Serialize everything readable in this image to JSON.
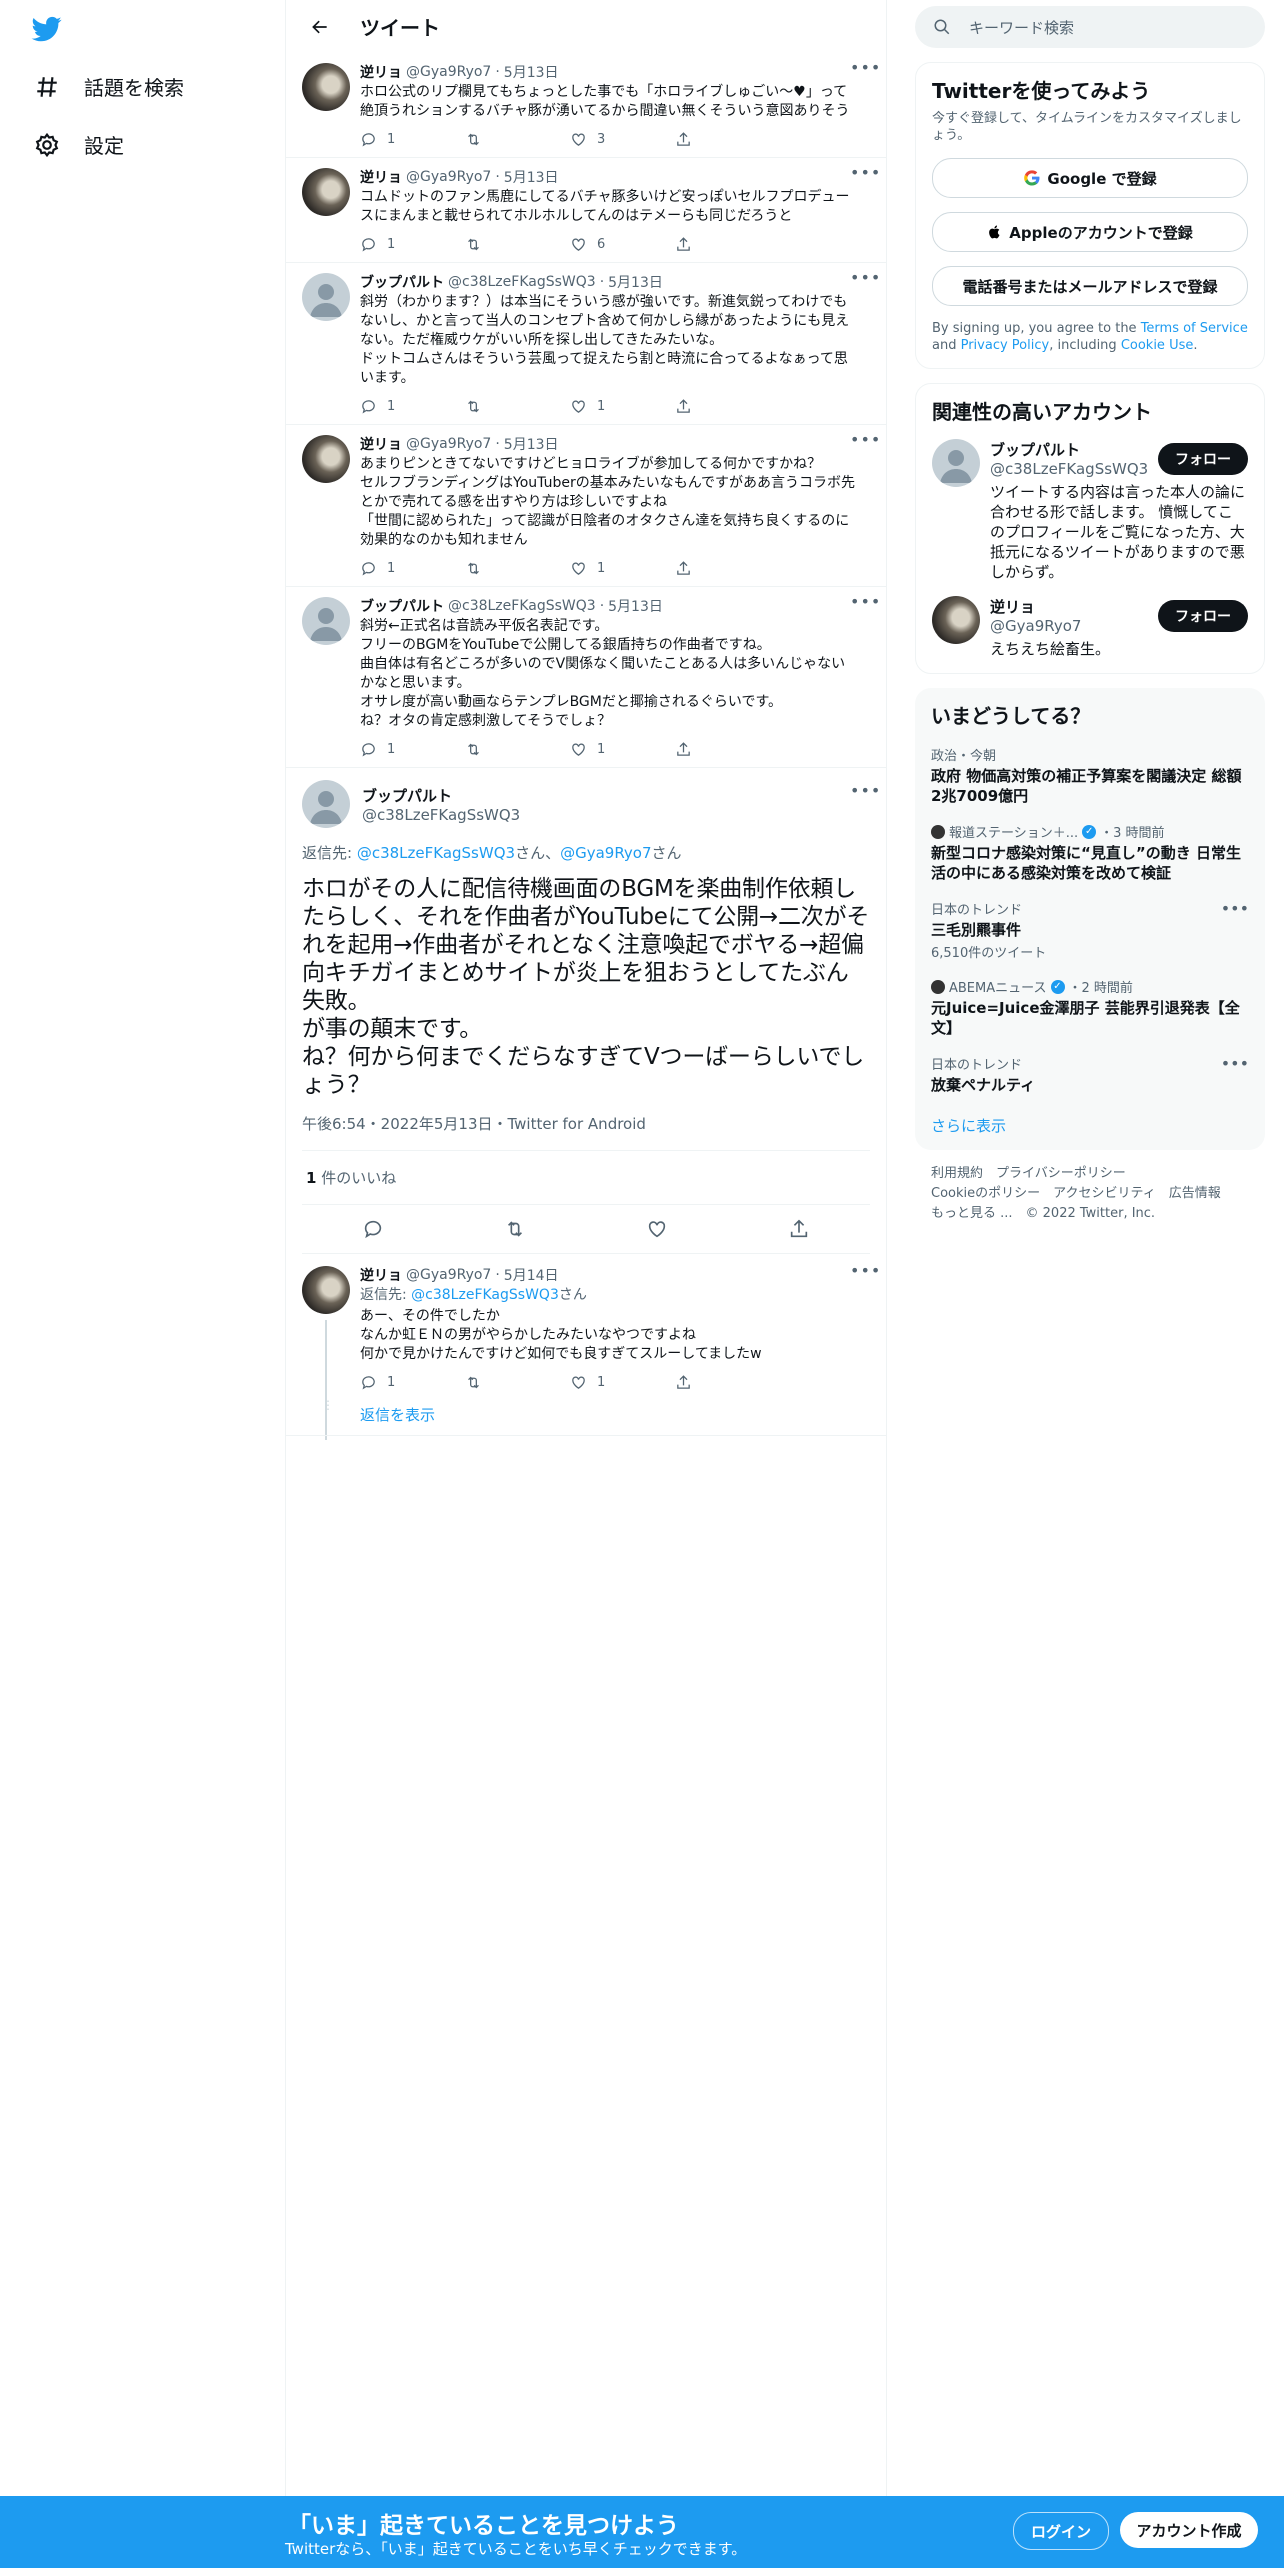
{
  "nav": {
    "explore_label": "話題を検索",
    "settings_label": "設定"
  },
  "header": {
    "title": "ツイート"
  },
  "replies_before": [
    {
      "name": "逆リョ",
      "handle": "@Gya9Ryo7",
      "date": "5月13日",
      "text": "ホロ公式のリプ欄見てもちょっとした事でも「ホロライブしゅごい〜♥」って絶頂うれションするバチャ豚が湧いてるから間違い無くそういう意図ありそう",
      "avatar": "dark",
      "replies": "1",
      "retweets": "",
      "likes": "3"
    },
    {
      "name": "逆リョ",
      "handle": "@Gya9Ryo7",
      "date": "5月13日",
      "text": "コムドットのファン馬鹿にしてるバチャ豚多いけど安っぽいセルフプロデュースにまんまと載せられてホルホルしてんのはテメーらも同じだろうと",
      "avatar": "dark",
      "replies": "1",
      "retweets": "",
      "likes": "6"
    },
    {
      "name": "ブップパルト",
      "handle": "@c38LzeFKagSsWQ3",
      "date": "5月13日",
      "text": "斜労（わかります？）は本当にそういう感が強いです。新進気鋭ってわけでもないし、かと言って当人のコンセプト含めて何かしら縁があったようにも見えない。ただ権威ウケがいい所を探し出してきたみたいな。\nドットコムさんはそういう芸風って捉えたら割と時流に合ってるよなぁって思います。",
      "avatar": "default",
      "replies": "1",
      "retweets": "",
      "likes": "1"
    },
    {
      "name": "逆リョ",
      "handle": "@Gya9Ryo7",
      "date": "5月13日",
      "text": "あまりピンときてないですけどヒョロライブが参加してる何かですかね？\nセルフブランディングはYouTuberの基本みたいなもんですがああ言うコラボ先とかで売れてる感を出すやり方は珍しいですよね\n「世間に認められた」って認識が日陰者のオタクさん達を気持ち良くするのに効果的なのかも知れません",
      "avatar": "dark",
      "replies": "1",
      "retweets": "",
      "likes": "1"
    },
    {
      "name": "ブップパルト",
      "handle": "@c38LzeFKagSsWQ3",
      "date": "5月13日",
      "text": "斜労←正式名は音読み平仮名表記です。\nフリーのBGMをYouTubeで公開してる銀盾持ちの作曲者ですね。\n曲自体は有名どころが多いのでV関係なく聞いたことある人は多いんじゃないかなと思います。\nオサレ度が高い動画ならテンプレBGMだと揶揄されるぐらいです。\nね？オタの肯定感刺激してそうでしょ？",
      "avatar": "default",
      "replies": "1",
      "retweets": "",
      "likes": "1"
    }
  ],
  "focus": {
    "name": "ブップパルト",
    "handle": "@c38LzeFKagSsWQ3",
    "reply_prefix": "返信先: ",
    "reply_to_1": "@c38LzeFKagSsWQ3",
    "reply_san_1": "さん、",
    "reply_to_2": "@Gya9Ryo7",
    "reply_san_2": "さん",
    "text": "ホロがその人に配信待機画面のBGMを楽曲制作依頼したらしく、それを作曲者がYouTubeにて公開→二次がそれを起用→作曲者がそれとなく注意喚起でボヤる→超偏向キチガイまとめサイトが炎上を狙おうとしてたぶん失敗。\nが事の顛末です。\nね？何から何までくだらなすぎてVつーばーらしいでしょう？",
    "meta": "午後6:54・2022年5月13日・Twitter for Android",
    "likes_count": "1",
    "likes_label": " 件のいいね"
  },
  "reply_after": {
    "name": "逆リョ",
    "handle": "@Gya9Ryo7",
    "date": "5月14日",
    "reply_prefix": "返信先: ",
    "reply_to": "@c38LzeFKagSsWQ3",
    "reply_san": "さん",
    "text": "あー、その件でしたか\nなんか虹ＥＮの男がやらかしたみたいなやつですよね\n何かで見かけたんですけど如何でも良すぎてスルーしてましたw",
    "replies": "1",
    "retweets": "",
    "likes": "1",
    "show_replies": "返信を表示"
  },
  "search": {
    "placeholder": "キーワード検索"
  },
  "signup_card": {
    "title": "Twitterを使ってみよう",
    "subtitle": "今すぐ登録して、タイムラインをカスタマイズしましょう。",
    "google": "Google で登録",
    "apple": "Appleのアカウントで登録",
    "phone": "電話番号またはメールアドレスで登録",
    "legal_1": "By signing up, you agree to the ",
    "terms": "Terms of Service",
    "legal_2": " and ",
    "privacy": "Privacy Policy",
    "legal_3": ", including ",
    "cookie": "Cookie Use",
    "legal_4": "."
  },
  "relevant": {
    "title": "関連性の高いアカウント",
    "accounts": [
      {
        "name": "ブップパルト",
        "handle": "@c38LzeFKagSsWQ3",
        "bio": "ツイートする内容は言った本人の論に合わせる形で話します。 憤慨してこのプロフィールをご覧になった方、大抵元になるツイートがありますので悪しからず。",
        "follow": "フォロー"
      },
      {
        "name": "逆リョ",
        "handle": "@Gya9Ryo7",
        "bio": "えちえち絵畜生。",
        "follow": "フォロー"
      }
    ]
  },
  "trends": {
    "title": "いまどうしてる？",
    "items": [
      {
        "meta": "政治・今朝",
        "title": "政府 物価高対策の補正予算案を閣議決定 総額2兆7009億円",
        "count": ""
      },
      {
        "meta": "報道ステーション＋...",
        "time": "・3 時間前",
        "title": "新型コロナ感染対策に“見直し”の動き 日常生活の中にある感染対策を改めて検証",
        "count": ""
      },
      {
        "meta": "日本のトレンド",
        "title": "三毛別羆事件",
        "count": "6,510件のツイート"
      },
      {
        "meta": "ABEMAニュース",
        "time": "・2 時間前",
        "title": "元Juice=Juice金澤朋子 芸能界引退発表【全文】",
        "count": ""
      },
      {
        "meta": "日本のトレンド",
        "title": "放棄ペナルティ",
        "count": ""
      }
    ],
    "show_more": "さらに表示"
  },
  "footer": {
    "line1": "利用規約　プライバシーポリシー",
    "line2": "Cookieのポリシー　アクセシビリティ　広告情報",
    "line3": "もっと見る ...　© 2022 Twitter, Inc."
  },
  "bottom_bar": {
    "title": "「いま」起きていることを見つけよう",
    "subtitle": "Twitterなら、「いま」起きていることをいち早くチェックできます。",
    "login": "ログイン",
    "signup": "アカウント作成"
  },
  "colors": {
    "accent": "#1d9bf0",
    "like_heart": "#f91880",
    "text": "#0f1419",
    "muted": "#536471"
  }
}
